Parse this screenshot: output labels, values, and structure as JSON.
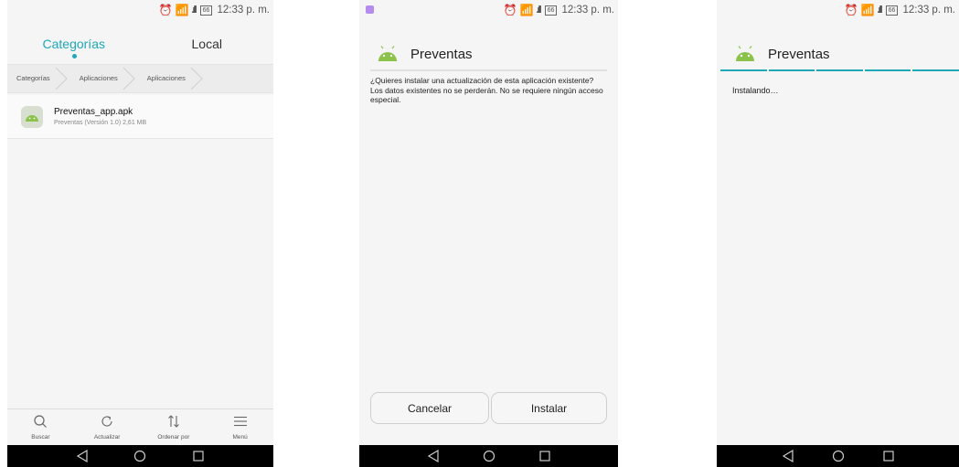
{
  "top_text": [
    "p",
    "p"
  ],
  "status": {
    "time": "12:33 p. m.",
    "battery": "66"
  },
  "screen1": {
    "tabs": [
      {
        "label": "Categorías"
      },
      {
        "label": "Local"
      }
    ],
    "breadcrumbs": [
      "Categorías",
      "Aplicaciones",
      "Aplicaciones"
    ],
    "file": {
      "name": "Preventas_app.apk",
      "meta": "Preventas (Versión 1.0) 2,61 MB"
    },
    "bottom_bar": [
      {
        "label": "Buscar",
        "icon": "search-icon"
      },
      {
        "label": "Actualizar",
        "icon": "refresh-icon"
      },
      {
        "label": "Ordenar por",
        "icon": "sort-icon"
      },
      {
        "label": "Menú",
        "icon": "menu-icon"
      }
    ]
  },
  "screen2": {
    "title": "Preventas",
    "message": "¿Quieres instalar una actualización de esta aplicación existente? Los datos existentes no se perderán. No se requiere ningún acceso especial.",
    "cancel_label": "Cancelar",
    "install_label": "Instalar"
  },
  "screen3": {
    "title": "Preventas",
    "message": "Instalando…"
  },
  "colors": {
    "accent": "#1ea8b8",
    "android_green": "#8bc34a",
    "navbar": "#000000"
  }
}
